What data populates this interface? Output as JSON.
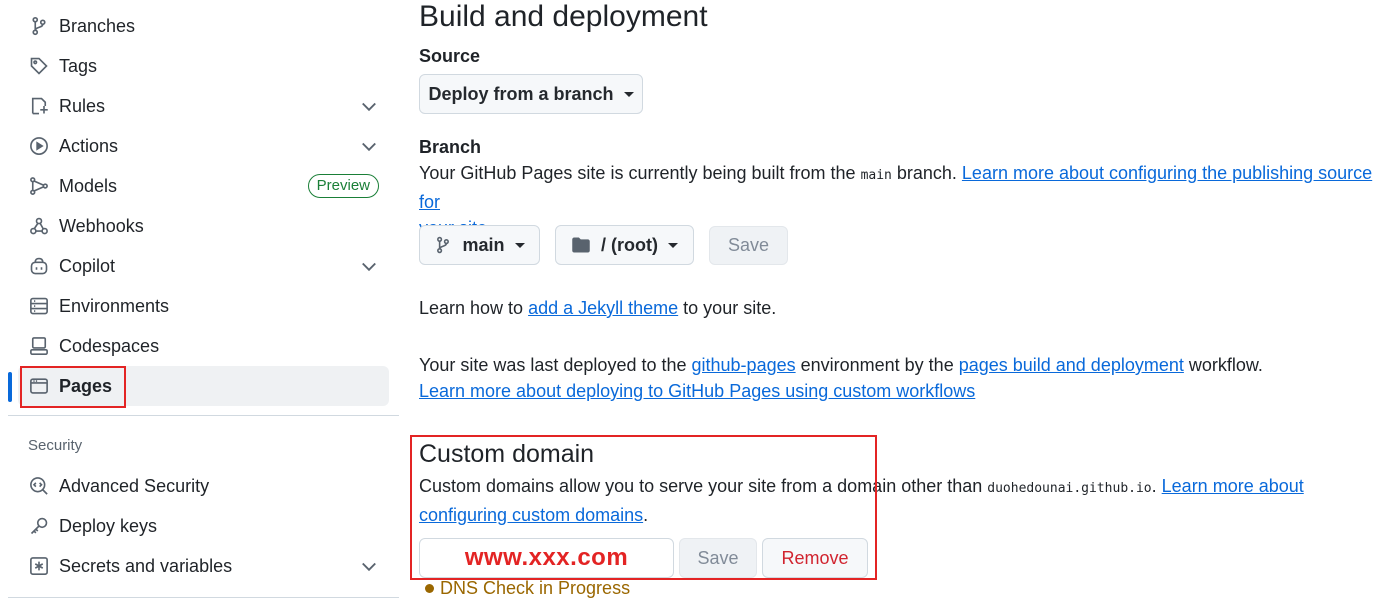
{
  "sidebar": {
    "items": [
      {
        "label": "Branches",
        "icon": "git-branch-icon"
      },
      {
        "label": "Tags",
        "icon": "tag-icon"
      },
      {
        "label": "Rules",
        "icon": "rules-icon"
      },
      {
        "label": "Actions",
        "icon": "play-icon"
      },
      {
        "label": "Models",
        "icon": "models-icon",
        "badge": "Preview"
      },
      {
        "label": "Webhooks",
        "icon": "webhook-icon"
      },
      {
        "label": "Copilot",
        "icon": "copilot-icon"
      },
      {
        "label": "Environments",
        "icon": "server-icon"
      },
      {
        "label": "Codespaces",
        "icon": "codespaces-icon"
      },
      {
        "label": "Pages",
        "icon": "browser-icon",
        "active": true
      }
    ],
    "security_heading": "Security",
    "security_items": [
      {
        "label": "Advanced Security",
        "icon": "codescan-icon"
      },
      {
        "label": "Deploy keys",
        "icon": "key-icon"
      },
      {
        "label": "Secrets and variables",
        "icon": "asterisk-icon"
      }
    ]
  },
  "main": {
    "title": "Build and deployment",
    "source_label": "Source",
    "source_value": "Deploy from a branch",
    "branch_label": "Branch",
    "branch_text_1": "Your GitHub Pages site is currently being built from the ",
    "branch_code": "main",
    "branch_text_2": " branch. ",
    "branch_link_1": "Learn more about configuring the publishing source for",
    "branch_link_2": "your site",
    "branch_text_3": ".",
    "branch_select": "main",
    "folder_select": "/ (root)",
    "save_label": "Save",
    "jekyll_text_1": "Learn how to ",
    "jekyll_link": "add a Jekyll theme",
    "jekyll_text_2": " to your site.",
    "deployed_text_1": "Your site was last deployed to the ",
    "deployed_link_1": "github-pages",
    "deployed_text_2": " environment by the ",
    "deployed_link_2": "pages build and deployment",
    "deployed_text_3": " workflow.",
    "deployed_link_3": "Learn more about deploying to GitHub Pages using custom workflows",
    "custom_domain_title": "Custom domain",
    "cd_text_1": "Custom domains allow you to serve your site from a domain other than ",
    "cd_code": "duohedounai.github.io",
    "cd_text_2": ". ",
    "cd_link_1": "Learn more about",
    "cd_link_2": "configuring custom domains",
    "cd_text_3": ".",
    "domain_value": "www.xxx.com",
    "save2_label": "Save",
    "remove_label": "Remove",
    "dns_status": "DNS Check in Progress"
  },
  "colors": {
    "accent": "#0969da",
    "highlight": "#e32424",
    "success": "#1a7f37",
    "attention": "#9a6700"
  }
}
